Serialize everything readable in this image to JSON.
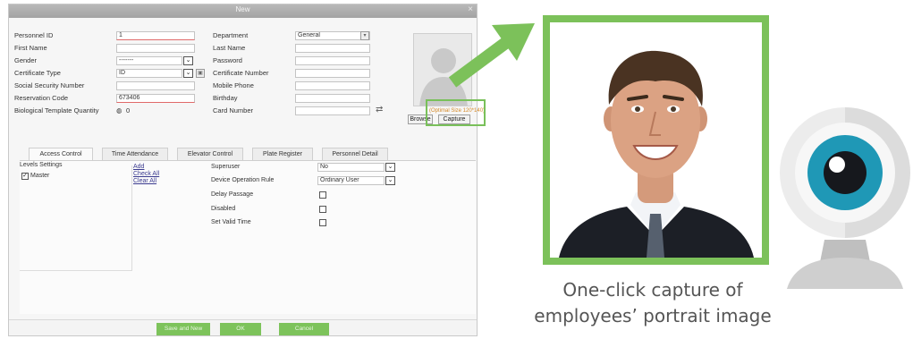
{
  "dialog": {
    "title": "New",
    "close_glyph": "×",
    "left_fields": [
      {
        "label": "Personnel ID",
        "value": "1"
      },
      {
        "label": "First Name",
        "value": ""
      },
      {
        "label": "Gender",
        "value": "-------"
      },
      {
        "label": "Certificate Type",
        "value": "ID"
      },
      {
        "label": "Social Security Number",
        "value": ""
      },
      {
        "label": "Reservation Code",
        "value": "673406"
      },
      {
        "label": "Biological Template Quantity",
        "value": "0"
      }
    ],
    "right_fields": [
      {
        "label": "Department",
        "value": "General"
      },
      {
        "label": "Last Name",
        "value": ""
      },
      {
        "label": "Password",
        "value": ""
      },
      {
        "label": "Certificate Number",
        "value": ""
      },
      {
        "label": "Mobile Phone",
        "value": ""
      },
      {
        "label": "Birthday",
        "value": ""
      },
      {
        "label": "Card Number",
        "value": ""
      }
    ],
    "photo_size_note": "(Optimal Size 120*140)",
    "browse_label": "Browse",
    "capture_label": "Capture",
    "tabs": [
      "Access Control",
      "Time Attendance",
      "Elevator Control",
      "Plate Register",
      "Personnel Detail"
    ],
    "levels_title": "Levels Settings",
    "levels_item": "Master",
    "links": [
      "Add",
      "Check All",
      "Clear All"
    ],
    "access_fields": [
      {
        "label": "Superuser",
        "value": "No",
        "kind": "select"
      },
      {
        "label": "Device Operation Rule",
        "value": "Ordinary User",
        "kind": "select"
      },
      {
        "label": "Delay Passage",
        "kind": "checkbox"
      },
      {
        "label": "Disabled",
        "kind": "checkbox"
      },
      {
        "label": "Set Valid Time",
        "kind": "checkbox"
      }
    ],
    "footer_buttons": [
      "Save and New",
      "OK",
      "Cancel"
    ]
  },
  "caption": {
    "line1": "One-click capture of",
    "line2": "employees’ portrait image"
  },
  "colors": {
    "accent_green": "#7cc15a",
    "webcam_blue": "#1f98b6"
  }
}
